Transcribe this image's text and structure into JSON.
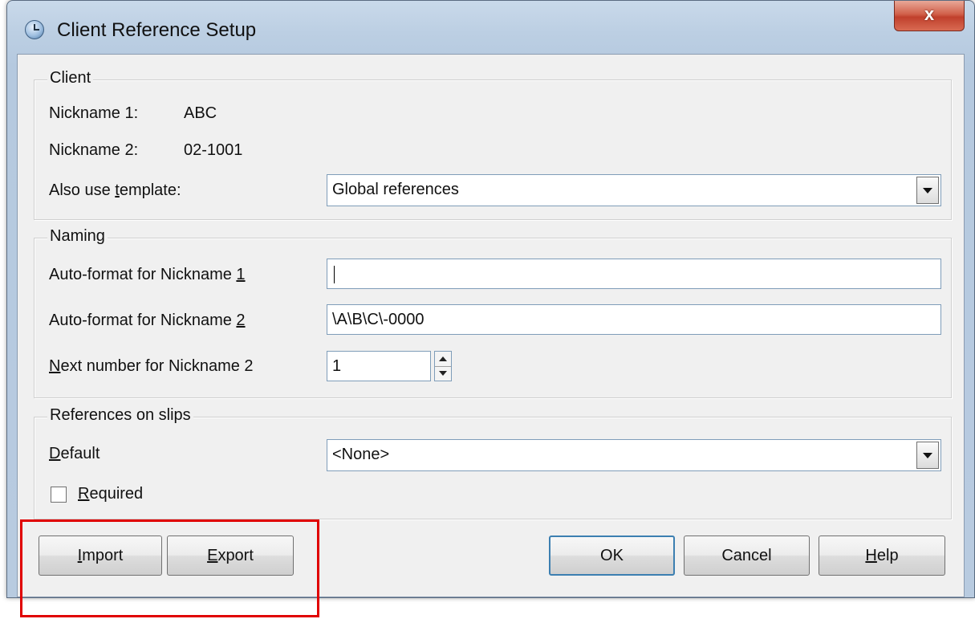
{
  "window": {
    "title": "Client Reference Setup",
    "close_glyph": "x"
  },
  "client": {
    "legend": "Client",
    "nickname1_label": "Nickname 1:",
    "nickname1_value": "ABC",
    "nickname2_label": "Nickname 2:",
    "nickname2_value": "02-1001",
    "template_label_pre": "Also use ",
    "template_label_ul": "t",
    "template_label_post": "emplate:",
    "template_value": "Global references"
  },
  "naming": {
    "legend": "Naming",
    "auto1_label_pre": "Auto-format for Nickname ",
    "auto1_label_ul": "1",
    "auto1_value": "",
    "auto2_label_pre": "Auto-format for Nickname ",
    "auto2_label_ul": "2",
    "auto2_value": "\\A\\B\\C\\-0000",
    "next_label_ul": "N",
    "next_label_post": "ext number for Nickname 2",
    "next_value": "1"
  },
  "slips": {
    "legend": "References on slips",
    "default_label_ul": "D",
    "default_label_post": "efault",
    "default_value": "<None>",
    "required_label_ul": "R",
    "required_label_post": "equired",
    "required_checked": false
  },
  "buttons": {
    "import_ul": "I",
    "import_post": "mport",
    "export_ul": "E",
    "export_post": "xport",
    "ok": "OK",
    "cancel": "Cancel",
    "help_ul": "H",
    "help_post": "elp"
  },
  "colors": {
    "highlight": "#e00000",
    "close_button": "#c0402c"
  }
}
